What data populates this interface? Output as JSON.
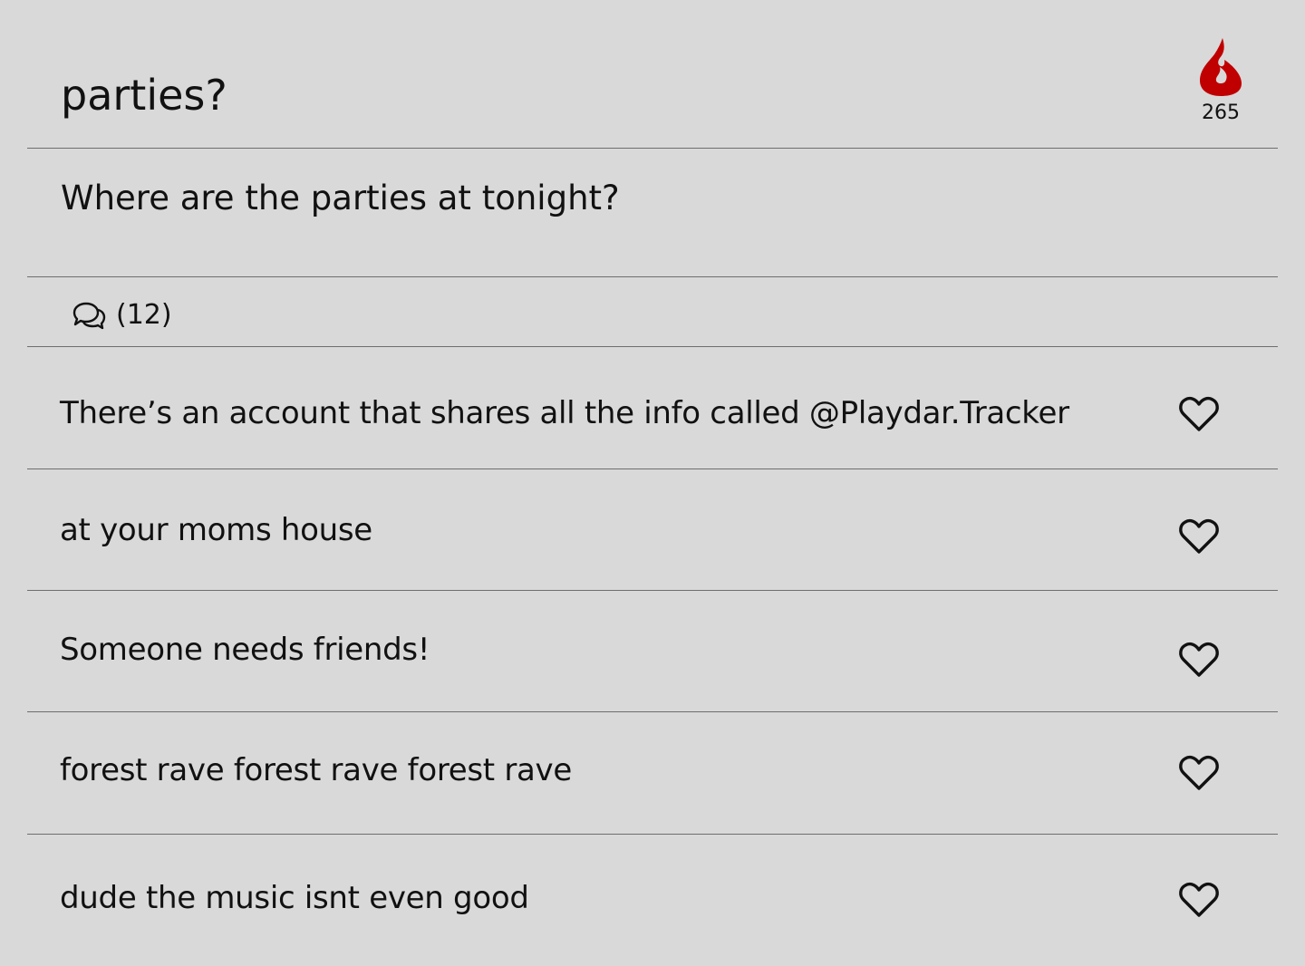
{
  "post": {
    "title": "parties?",
    "body": "Where are the parties at tonight?",
    "heat_count": "265",
    "comment_count_label": "(12)"
  },
  "icons": {
    "heat": "flame-icon",
    "comments": "speech-bubbles-icon",
    "like": "heart-outline-icon"
  },
  "colors": {
    "background": "#d9d9d9",
    "flame": "#c00000",
    "divider": "#6e6e6e"
  },
  "replies": [
    {
      "text": "There’s an account that shares all the info called @Playdar.Tracker"
    },
    {
      "text": "at your moms house"
    },
    {
      "text": "Someone needs friends!"
    },
    {
      "text": "forest rave forest rave forest rave"
    },
    {
      "text": "dude the music isnt even good"
    }
  ]
}
